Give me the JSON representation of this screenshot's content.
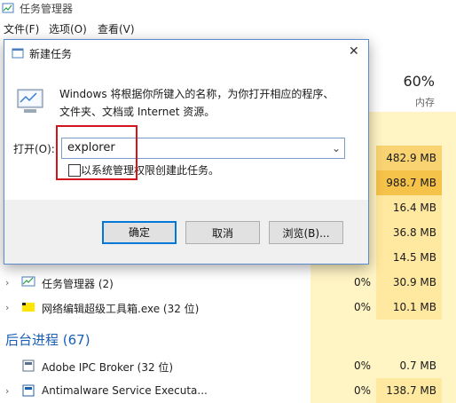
{
  "task_manager": {
    "title": "任务管理器",
    "menu": [
      "文件(F)",
      "选项(O)",
      "查看(V)"
    ],
    "memory_header": {
      "percent": "60%",
      "label": "内存"
    },
    "rows": [
      {
        "cpu": "",
        "memory": "482.9 MB"
      },
      {
        "cpu": "",
        "memory": "988.7 MB"
      },
      {
        "cpu": "",
        "memory": "16.4 MB"
      },
      {
        "cpu": "",
        "memory": "36.8 MB"
      },
      {
        "cpu": "",
        "memory": "14.5 MB"
      },
      {
        "name": "任务管理器 (2)",
        "cpu": "0%",
        "memory": "30.9 MB"
      },
      {
        "name": "网络编辑超级工具箱.exe (32 位)",
        "cpu": "0%",
        "memory": "10.1 MB"
      }
    ],
    "background_section": "后台进程 (67)",
    "bg_rows": [
      {
        "name": "Adobe IPC Broker (32 位)",
        "cpu": "0%",
        "memory": "0.7 MB"
      },
      {
        "name": "Antimalware Service Executa...",
        "cpu": "0%",
        "memory": "138.7 MB"
      }
    ],
    "highlight_colors": {
      "light": "#fff4c4",
      "medium": "#ffe8a0",
      "strong": "#f9d371"
    }
  },
  "dialog": {
    "title": "新建任务",
    "description_line1": "Windows 将根据你所键入的名称，为你打开相应的程序、",
    "description_line2": "文件夹、文档或 Internet 资源。",
    "open_label": "打开(O):",
    "open_value": "explorer",
    "checkbox_label": "以系统管理权限创建此任务。",
    "ok": "确定",
    "cancel": "取消",
    "browse": "浏览(B)...",
    "close_glyph": "✕"
  }
}
